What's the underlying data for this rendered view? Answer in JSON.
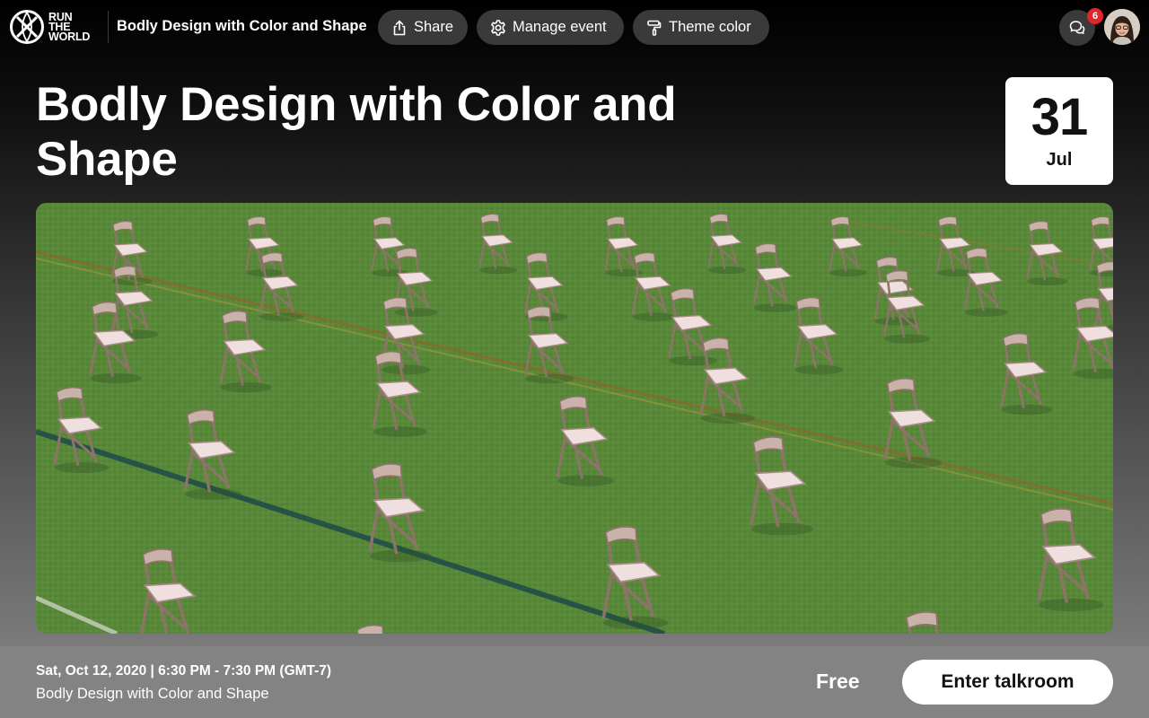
{
  "brand": {
    "logo_lines": [
      "RUN",
      "THE",
      "WORLD"
    ]
  },
  "topbar": {
    "event_name": "Bodly Design with Color and Shape",
    "share_label": "Share",
    "manage_label": "Manage event",
    "theme_label": "Theme color",
    "chat_badge": "6"
  },
  "event": {
    "title": "Bodly Design with Color and Shape",
    "date_day": "31",
    "date_month": "Jul",
    "datetime": "Sat, Oct 12, 2020 | 6:30 PM - 7:30 PM (GMT-7)",
    "subtitle": "Bodly Design with Color and Shape",
    "price": "Free",
    "enter_label": "Enter talkroom"
  },
  "colors": {
    "accent_badge": "#e0262d",
    "pill_bg": "#3a3a3a",
    "grass": "#5a8a38"
  },
  "icons": {
    "share": "share-icon",
    "manage": "gear-icon",
    "theme": "paint-roller-icon",
    "chat": "chat-bubbles-icon"
  }
}
